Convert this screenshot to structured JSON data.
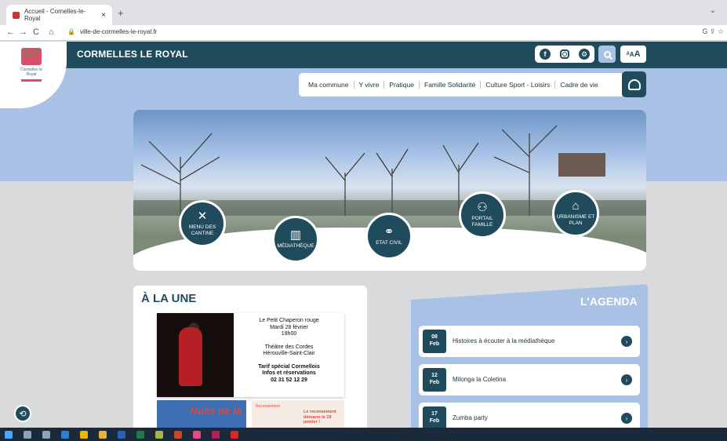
{
  "browser": {
    "tab_title": "Accueil - Cornelles-le-Royal",
    "tab_close": "×",
    "new_tab": "+",
    "url": "ville-de-cormelles-le-royal.fr",
    "back": "←",
    "forward": "→",
    "reload": "C",
    "home": "⌂",
    "lock": "🔒",
    "window_control": "⌄",
    "address_right_icons": "G ⇪ ☆"
  },
  "site": {
    "title": "CORMELLES LE ROYAL",
    "logo_text": "Cormelles le Royal",
    "font_size_label": "AAA",
    "menu": [
      "Ma commune",
      "Y vivre",
      "Pratique",
      "Famille Solidarité",
      "Culture Sport - Loisirs",
      "Cadre de vie"
    ],
    "shortcuts": [
      {
        "label": "MENU DES CANTINE",
        "icon": "✕"
      },
      {
        "label": "MÉDIATHÈQUE",
        "icon": "▥"
      },
      {
        "label": "ETAT CIVIL",
        "icon": "⚭"
      },
      {
        "label": "PORTAIL FAMILLE",
        "icon": "⚇"
      },
      {
        "label": "URBANISME ET PLAN",
        "icon": "⌂"
      }
    ],
    "news": {
      "heading": "À LA UNE",
      "card1": {
        "line1": "Le Petit Chaperon rouge",
        "line2": "Mardi 28 février",
        "line3": "19h00",
        "line4": "Théâtre des Cordes",
        "line5": "Hérouville-Saint-Clair",
        "line6": "Tarif spécial Cormellois",
        "line7": "Infos et réservations",
        "line8": "02 31 52 12 29"
      },
      "card2_text": "Nuits de la",
      "card3_logo": "Recensement",
      "card3_text": "Le recensement démarre le 19 janvier !"
    },
    "agenda": {
      "heading": "L'AGENDA",
      "events": [
        {
          "day": "08",
          "month": "Feb",
          "name": "Histoires à écouter à la médiathèque"
        },
        {
          "day": "12",
          "month": "Feb",
          "name": "Milonga la Coletina"
        },
        {
          "day": "17",
          "month": "Feb",
          "name": "Zumba party"
        }
      ]
    }
  }
}
